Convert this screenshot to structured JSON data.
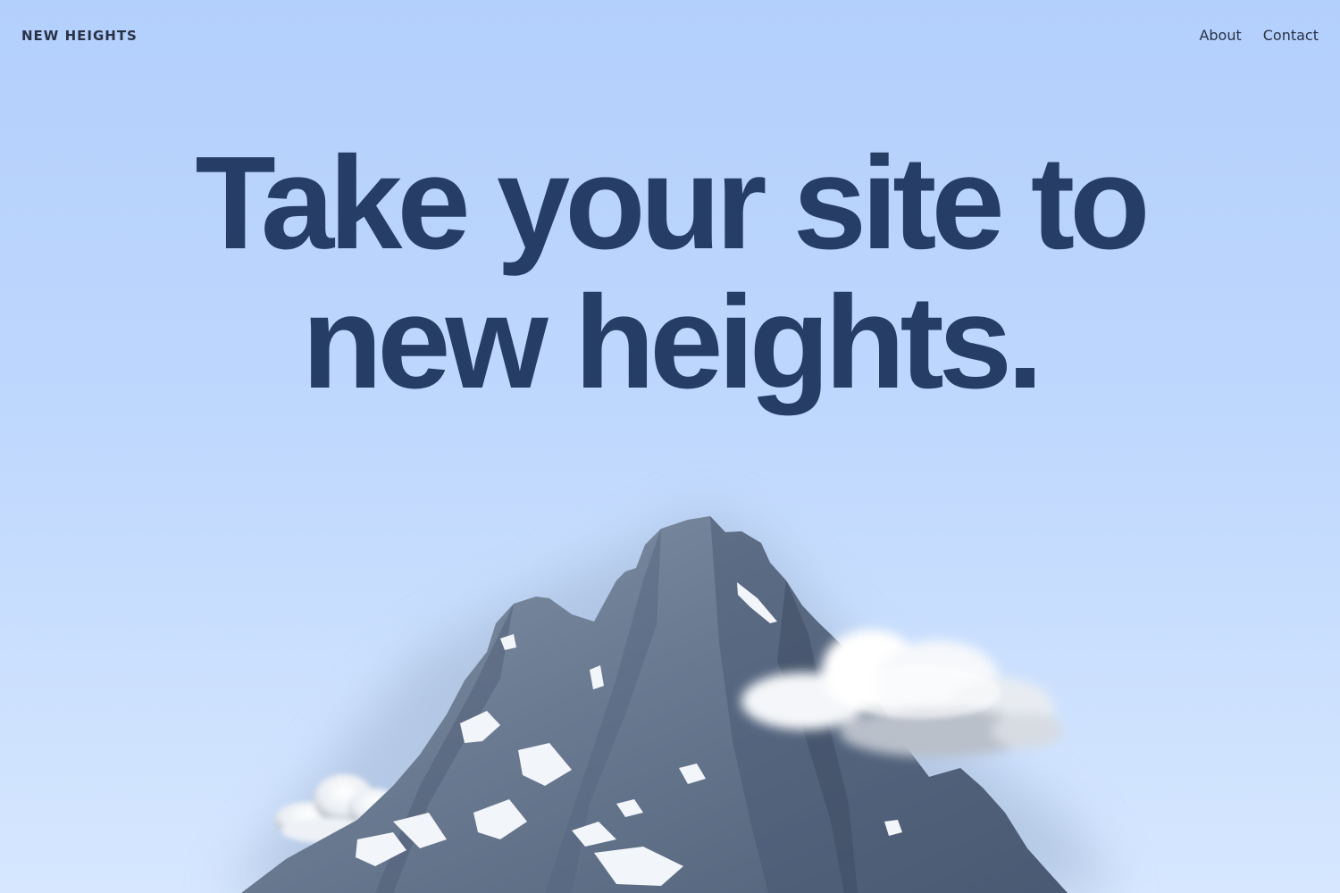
{
  "header": {
    "brand": "NEW HEIGHTS",
    "nav": [
      {
        "label": "About"
      },
      {
        "label": "Contact"
      }
    ]
  },
  "hero": {
    "line1": "Take your site to",
    "line2": "new heights."
  },
  "colors": {
    "sky_top": "#b3cffc",
    "sky_bottom": "#d6e7ff",
    "headline": "#263d66",
    "nav_text": "#2a3246",
    "rock": "#6f7f95",
    "snow": "#f4f7fb"
  }
}
